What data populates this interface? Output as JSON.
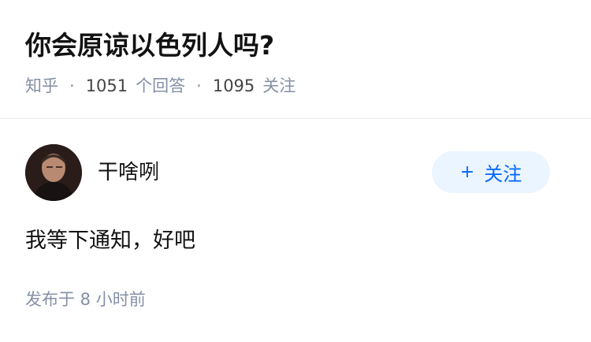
{
  "question": {
    "title": "你会原谅以色列人吗?",
    "source": "知乎",
    "separator": "·",
    "answer_count": "1051",
    "answer_label": "个回答",
    "follower_count": "1095",
    "follower_label": "关注"
  },
  "answer": {
    "author_name": "干啥咧",
    "follow_plus": "+",
    "follow_label": "关注",
    "content": "我等下通知，好吧",
    "published": "发布于 8 小时前"
  },
  "colors": {
    "accent": "#0066ff",
    "follow_bg": "#ebf5ff",
    "meta_text": "#8590a6",
    "primary_text": "#121212"
  },
  "icons": {
    "plus": "plus-icon"
  }
}
